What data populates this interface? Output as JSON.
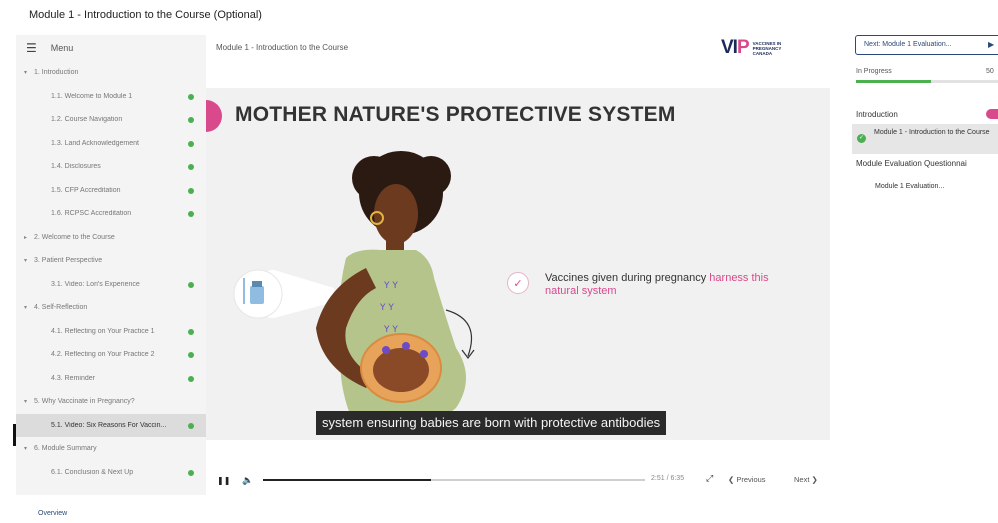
{
  "page": {
    "title": "Module 1 - Introduction to the Course (Optional)"
  },
  "sidebar": {
    "menu_label": "Menu",
    "sections": [
      {
        "label": "1. Introduction",
        "expanded": true,
        "items": [
          {
            "label": "1.1. Welcome to Module 1",
            "complete": true
          },
          {
            "label": "1.2. Course Navigation",
            "complete": true
          },
          {
            "label": "1.3. Land Acknowledgement",
            "complete": true
          },
          {
            "label": "1.4. Disclosures",
            "complete": true
          },
          {
            "label": "1.5. CFP Accreditation",
            "complete": true
          },
          {
            "label": "1.6. RCPSC Accreditation",
            "complete": true
          }
        ]
      },
      {
        "label": "2. Welcome to the Course",
        "expanded": false,
        "items": []
      },
      {
        "label": "3. Patient Perspective",
        "expanded": true,
        "items": [
          {
            "label": "3.1. Video: Lori's Experience",
            "complete": true
          }
        ]
      },
      {
        "label": "4. Self-Reflection",
        "expanded": true,
        "items": [
          {
            "label": "4.1. Reflecting on Your Practice 1",
            "complete": true
          },
          {
            "label": "4.2. Reflecting on Your Practice 2",
            "complete": true
          },
          {
            "label": "4.3. Reminder",
            "complete": true
          }
        ]
      },
      {
        "label": "5. Why Vaccinate in Pregnancy?",
        "expanded": true,
        "items": [
          {
            "label": "5.1. Video: Six Reasons For Vaccin...",
            "complete": true,
            "active": true
          }
        ]
      },
      {
        "label": "6. Module Summary",
        "expanded": true,
        "items": [
          {
            "label": "6.1. Conclusion & Next Up",
            "complete": true
          }
        ]
      }
    ],
    "overview_label": "Overview"
  },
  "main": {
    "title": "Module 1 - Introduction to the Course",
    "logo": {
      "mark_left": "VI",
      "mark_right": "P",
      "line1": "VACCINES IN",
      "line2": "PREGNANCY",
      "line3": "CANADA"
    }
  },
  "video": {
    "slide_title": "MOTHER NATURE'S PROTECTIVE SYSTEM",
    "claim_plain": "Vaccines given during pregnancy ",
    "claim_highlight": "harness this natural system",
    "caption": "system ensuring babies are born with protective antibodies",
    "time": "2:51 / 6:35",
    "progress_fraction": 0.44,
    "prev_label": "Previous",
    "next_label": "Next",
    "colors": {
      "accent": "#d94a8c",
      "skin": "#6b3a1f",
      "dress": "#b5c48a",
      "hair": "#2b1a12"
    }
  },
  "right_panel": {
    "next_button_label": "Next: Module 1 Evaluation...",
    "status_label": "In Progress",
    "percent_label": "50",
    "progress_fraction": 0.5,
    "section1": "Introduction",
    "current_item": "Module 1 - Introduction to the Course",
    "section2": "Module Evaluation Questionnai",
    "eval_item": "Module 1 Evaluation..."
  }
}
